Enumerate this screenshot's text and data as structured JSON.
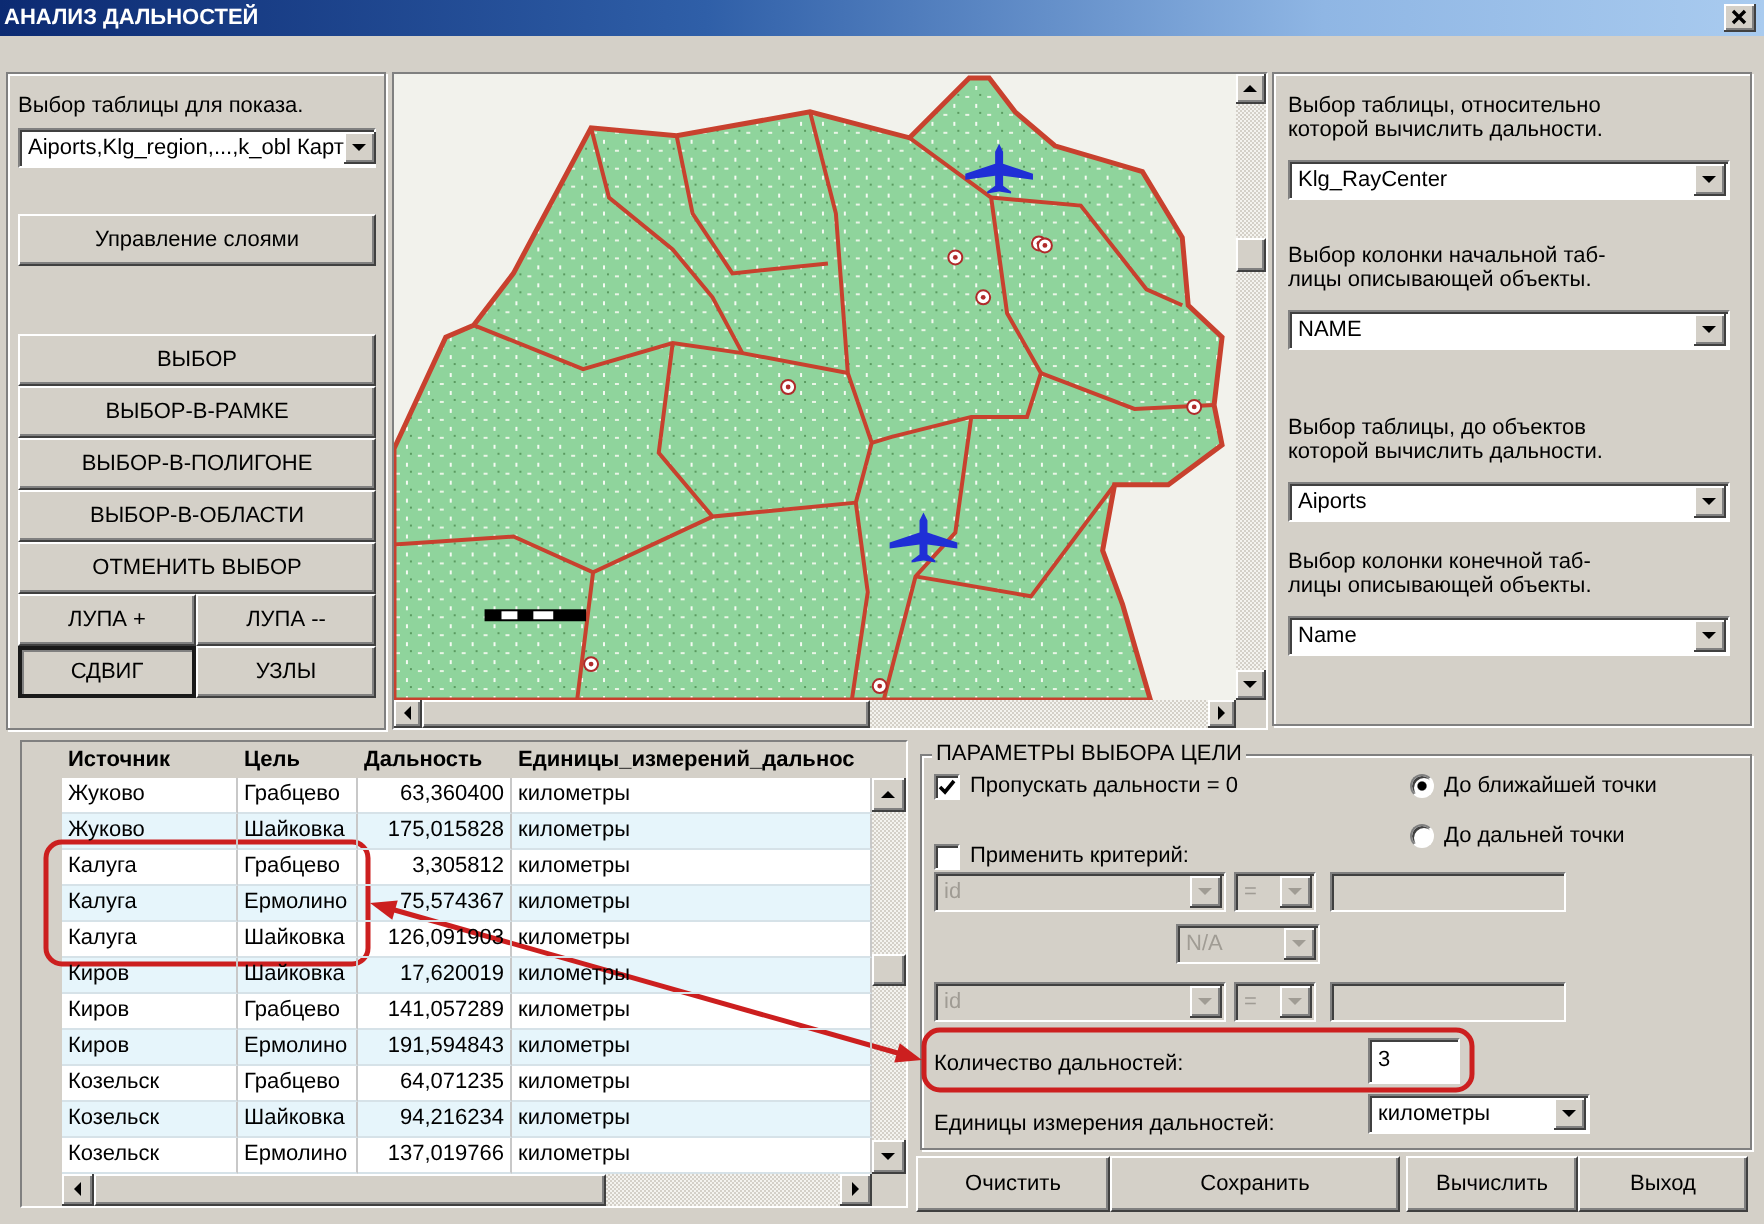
{
  "window": {
    "title": "АНАЛИЗ ДАЛЬНОСТЕЙ"
  },
  "display_panel": {
    "label": "Выбор таблицы для показа.",
    "select": {
      "value": "Aiports,Klg_region,...,k_obl Карт"
    },
    "layers_button": "Управление слоями",
    "tools": [
      {
        "label": "ВЫБОР",
        "kind": "wide",
        "selected": false
      },
      {
        "label": "ВЫБОР-В-РАМКЕ",
        "kind": "wide",
        "selected": false
      },
      {
        "label": "ВЫБОР-В-ПОЛИГОНЕ",
        "kind": "wide",
        "selected": false
      },
      {
        "label": "ВЫБОР-В-ОБЛАСТИ",
        "kind": "wide",
        "selected": false
      },
      {
        "label": "ОТМЕНИТЬ ВЫБОР",
        "kind": "wide",
        "selected": false
      },
      {
        "label": "ЛУПА +",
        "kind": "half",
        "selected": false
      },
      {
        "label": "ЛУПА --",
        "kind": "half",
        "selected": false
      },
      {
        "label": "СДВИГ",
        "kind": "half",
        "selected": true
      },
      {
        "label": "УЗЛЫ",
        "kind": "half",
        "selected": false
      }
    ]
  },
  "distance_panel": {
    "fields": [
      {
        "label": "Выбор таблицы, относительно\nкоторой вычислить дальности.",
        "value": "Klg_RayCenter"
      },
      {
        "label": "Выбор колонки начальной таб-\nлицы описывающей объекты.",
        "value": "NAME"
      },
      {
        "label": "Выбор таблицы, до объектов\nкоторой вычислить дальности.",
        "value": "Aiports"
      },
      {
        "label": "Выбор колонки конечной таб-\nлицы описывающей объекты.",
        "value": "Name"
      }
    ]
  },
  "results_table": {
    "columns": [
      "Источник",
      "Цель",
      "Дальность",
      "Единицы_измерений_дальнос"
    ],
    "rows": [
      {
        "cells": [
          "Жуково",
          "Грабцево",
          "63,360400",
          "километры"
        ],
        "highlighted": false
      },
      {
        "cells": [
          "Жуково",
          "Шайковка",
          "175,015828",
          "километры"
        ],
        "highlighted": false
      },
      {
        "cells": [
          "Калуга",
          "Грабцево",
          "3,305812",
          "километры"
        ],
        "highlighted": true
      },
      {
        "cells": [
          "Калуга",
          "Ермолино",
          "75,574367",
          "километры"
        ],
        "highlighted": true
      },
      {
        "cells": [
          "Калуга",
          "Шайковка",
          "126,091903",
          "километры"
        ],
        "highlighted": true
      },
      {
        "cells": [
          "Киров",
          "Шайковка",
          "17,620019",
          "километры"
        ],
        "highlighted": false
      },
      {
        "cells": [
          "Киров",
          "Грабцево",
          "141,057289",
          "километры"
        ],
        "highlighted": false
      },
      {
        "cells": [
          "Киров",
          "Ермолино",
          "191,594843",
          "километры"
        ],
        "highlighted": false
      },
      {
        "cells": [
          "Козельск",
          "Грабцево",
          "64,071235",
          "километры"
        ],
        "highlighted": false
      },
      {
        "cells": [
          "Козельск",
          "Шайковка",
          "94,216234",
          "километры"
        ],
        "highlighted": false
      },
      {
        "cells": [
          "Козельск",
          "Ермолино",
          "137,019766",
          "километры"
        ],
        "highlighted": false
      }
    ]
  },
  "target_params": {
    "title": "ПАРАМЕТРЫ ВЫБОРА ЦЕЛИ",
    "skip_zero": {
      "label": "Пропускать дальности = 0",
      "checked": true
    },
    "apply_criteria": {
      "label": "Применить критерий:",
      "checked": false
    },
    "modes": [
      {
        "label": "До ближайшей точки",
        "selected": true
      },
      {
        "label": "До дальней точки",
        "selected": false
      }
    ],
    "criteria": [
      {
        "kind": "condition",
        "field": "id",
        "operator": "=",
        "disabled": true
      },
      {
        "kind": "join",
        "value": "N/A",
        "disabled": true
      },
      {
        "kind": "condition",
        "field": "id",
        "operator": "=",
        "disabled": true
      }
    ],
    "count": {
      "label": "Количество дальностей:",
      "value": "3",
      "highlighted": true
    },
    "units": {
      "label": "Единицы измерения дальностей:",
      "value": "километры"
    }
  },
  "buttons": [
    "Очистить",
    "Сохранить",
    "Вычислить",
    "Выход"
  ]
}
